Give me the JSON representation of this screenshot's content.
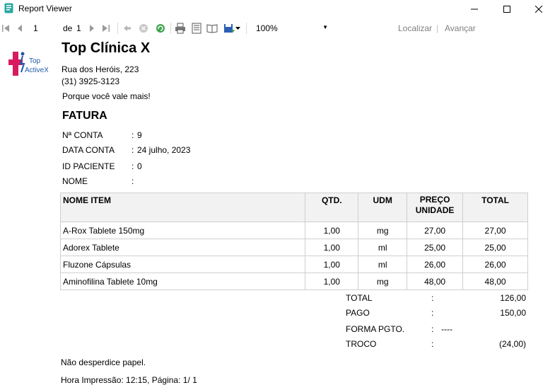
{
  "window": {
    "title": "Report Viewer"
  },
  "toolbar": {
    "page_current": "1",
    "page_of_label": "de",
    "page_total": "1",
    "zoom": "100%",
    "find_label": "Localizar",
    "find_separator": "|",
    "next_label": "Avançar"
  },
  "report": {
    "clinic_name": "Top Clínica X",
    "logo": {
      "line1": "Top",
      "line2": "ActiveX"
    },
    "address": "Rua dos Heróis, 223",
    "phone": "(31) 3925-3123",
    "slogan": "Porque você vale mais!",
    "heading": "FATURA",
    "info": [
      {
        "label": "Nª CONTA",
        "sep": ":",
        "value": "9"
      },
      {
        "label": "DATA CONTA",
        "sep": ":",
        "value": "24 julho, 2023"
      },
      {
        "label": "ID PACIENTE",
        "sep": ":",
        "value": "0"
      },
      {
        "label": "NOME",
        "sep": ":",
        "value": ""
      }
    ],
    "table": {
      "headers": [
        "NOME ITEM",
        "QTD.",
        "UDM",
        "PREÇO",
        "UNIDADE",
        "TOTAL"
      ],
      "rows": [
        [
          "A-Rox Tablete 150mg",
          "1,00",
          "mg",
          "27,00",
          "27,00"
        ],
        [
          "Adorex Tablete",
          "1,00",
          "ml",
          "25,00",
          "25,00"
        ],
        [
          "Fluzone Cápsulas",
          "1,00",
          "ml",
          "26,00",
          "26,00"
        ],
        [
          "Aminofilina Tablete 10mg",
          "1,00",
          "mg",
          "48,00",
          "48,00"
        ]
      ]
    },
    "summary": [
      {
        "label": "TOTAL",
        "sep": ":",
        "value": "126,00"
      },
      {
        "label": "PAGO",
        "sep": ":",
        "value": "150,00"
      },
      {
        "label": "FORMA PGTO.",
        "sep": ":",
        "value": "----"
      },
      {
        "label": "TROCO",
        "sep": ":",
        "value": "(24,00)"
      }
    ],
    "footer_note": "Não desperdice papel.",
    "print_info": "Hora Impressão: 12:15, Página: 1/ 1"
  },
  "colors": {
    "logo_red": "#d81b60",
    "logo_blue": "#1e5aa8",
    "header_bg": "#f2f2f2",
    "border": "#cfcfcf"
  }
}
